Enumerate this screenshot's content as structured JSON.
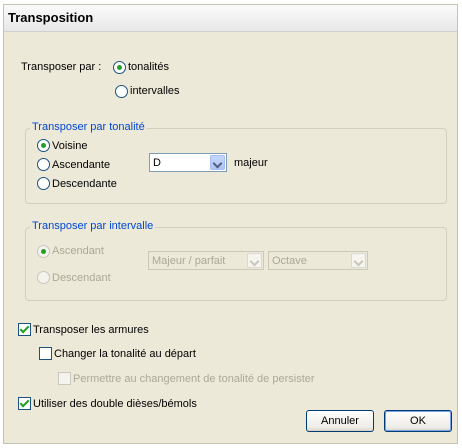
{
  "window": {
    "title": "Transposition"
  },
  "transpose_by": {
    "label": "Transposer par :",
    "options": {
      "keys": "tonalités",
      "intervals": "intervalles"
    },
    "selected": "keys"
  },
  "by_key": {
    "legend": "Transposer par tonalité",
    "options": {
      "nearest": "Voisine",
      "up": "Ascendante",
      "down": "Descendante"
    },
    "selected": "nearest",
    "key_value": "D",
    "mode_label": "majeur"
  },
  "by_interval": {
    "legend": "Transposer par intervalle",
    "options": {
      "up": "Ascendant",
      "down": "Descendant"
    },
    "quality_value": "Majeur / parfait",
    "interval_value": "Octave",
    "enabled": false
  },
  "options": {
    "transpose_key_signatures": {
      "label": "Transposer les armures",
      "checked": true
    },
    "change_key_at_start": {
      "label": "Changer la tonalité au départ",
      "checked": false
    },
    "allow_key_change_persist": {
      "label": "Permettre au changement de tonalité de persister",
      "checked": false,
      "enabled": false
    },
    "use_double_accidentals": {
      "label": "Utiliser des double dièses/bémols",
      "checked": true
    }
  },
  "buttons": {
    "cancel": "Annuler",
    "ok": "OK"
  }
}
